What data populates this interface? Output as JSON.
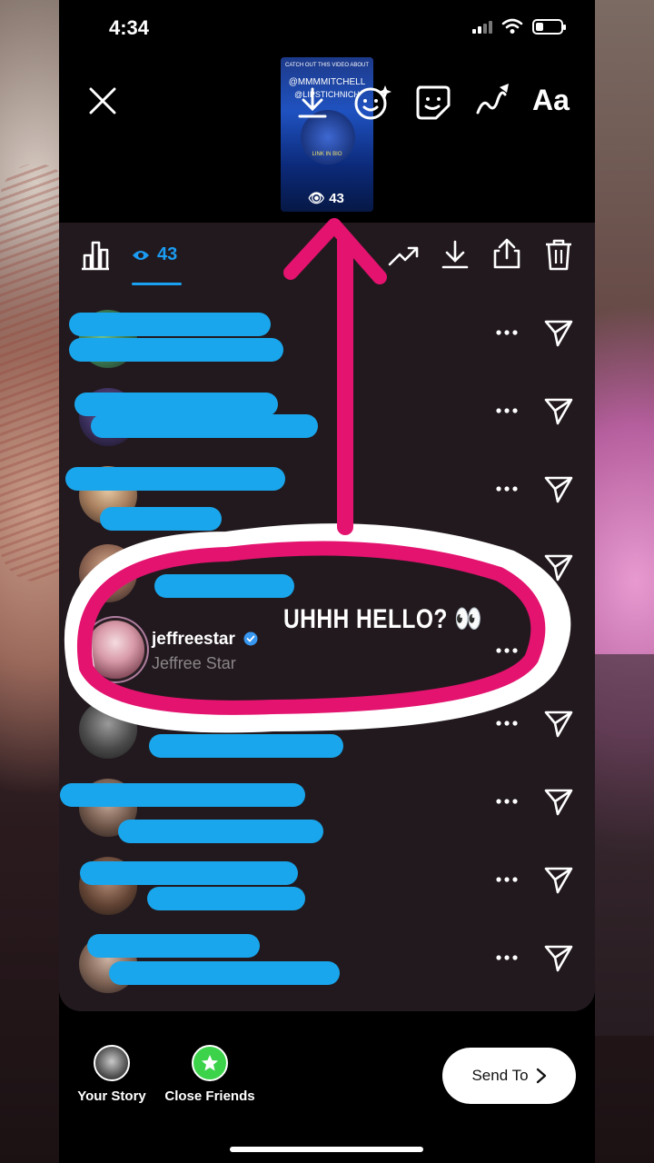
{
  "status_bar": {
    "time": "4:34"
  },
  "story_preview": {
    "view_count": "43",
    "lines": [
      "CATCH OUT THIS VIDEO ABOUT",
      "@MMMMITCHELL",
      "@LIPSTICHNICH",
      "LINK IN BIO"
    ]
  },
  "top_toolbar": {
    "text_tool_label": "Aa"
  },
  "viewers_header": {
    "views_label": "43"
  },
  "viewers": [
    {
      "name": "",
      "subtitle": ""
    },
    {
      "name": "",
      "subtitle": ""
    },
    {
      "name": "",
      "subtitle": ""
    },
    {
      "name": "",
      "subtitle": ""
    },
    {
      "name": "jeffreestar",
      "subtitle": "Jeffree Star",
      "verified": true
    },
    {
      "name": "",
      "subtitle": ""
    },
    {
      "name": "",
      "subtitle": ""
    },
    {
      "name": "",
      "subtitle": ""
    },
    {
      "name": "",
      "subtitle": ""
    }
  ],
  "annotation": {
    "text": "UHHH HELLO? 👀"
  },
  "bottom": {
    "your_story_label": "Your Story",
    "close_friends_label": "Close Friends",
    "send_to_label": "Send To"
  },
  "colors": {
    "accent_blue": "#1b9cf2",
    "marker_pink": "#e3136f",
    "scribble_blue": "#19a6ec",
    "close_friends_green": "#3cd34b"
  }
}
